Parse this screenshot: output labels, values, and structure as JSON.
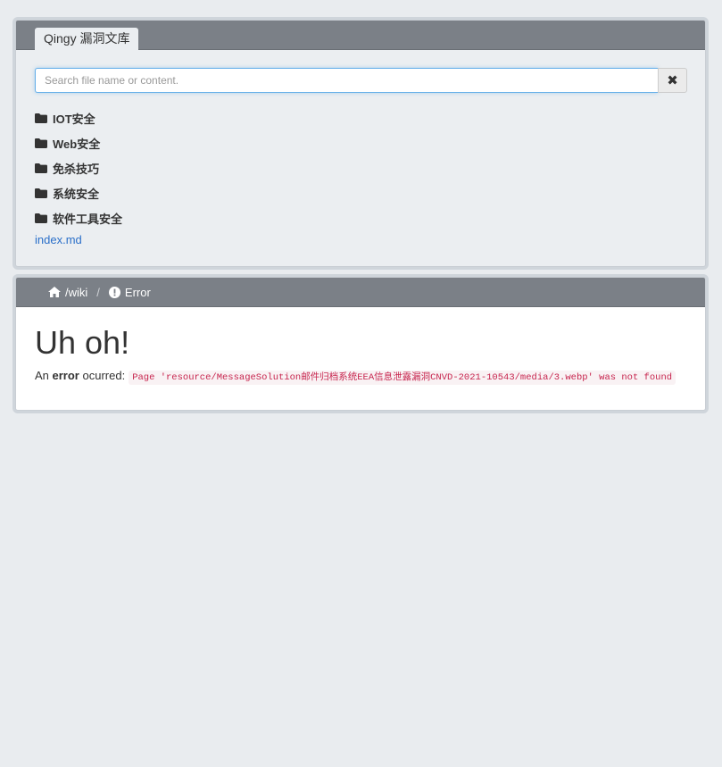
{
  "brand": {
    "title": "Qingy 漏洞文库"
  },
  "search": {
    "placeholder": "Search file name or content.",
    "value": "",
    "clear_icon": "times-icon"
  },
  "sidebar": {
    "folders": [
      {
        "label": "IOT安全",
        "icon": "folder-icon"
      },
      {
        "label": "Web安全",
        "icon": "folder-icon"
      },
      {
        "label": "免杀技巧",
        "icon": "folder-icon"
      },
      {
        "label": "系统安全",
        "icon": "folder-icon"
      },
      {
        "label": "软件工具安全",
        "icon": "folder-icon"
      }
    ],
    "file": {
      "label": "index.md"
    }
  },
  "breadcrumb": {
    "home_label": "/wiki",
    "separator": "/",
    "current_label": "Error"
  },
  "error": {
    "heading": "Uh oh!",
    "prefix": "An ",
    "strong": "error",
    "suffix": " ocurred:",
    "code": "Page 'resource/MessageSolution邮件归档系统EEA信息泄露漏洞CNVD-2021-10543/media/3.webp' was not found"
  },
  "colors": {
    "header": "#7b8087",
    "link": "#2a6fc9",
    "code": "#c7254e",
    "background": "#e9ecef"
  }
}
